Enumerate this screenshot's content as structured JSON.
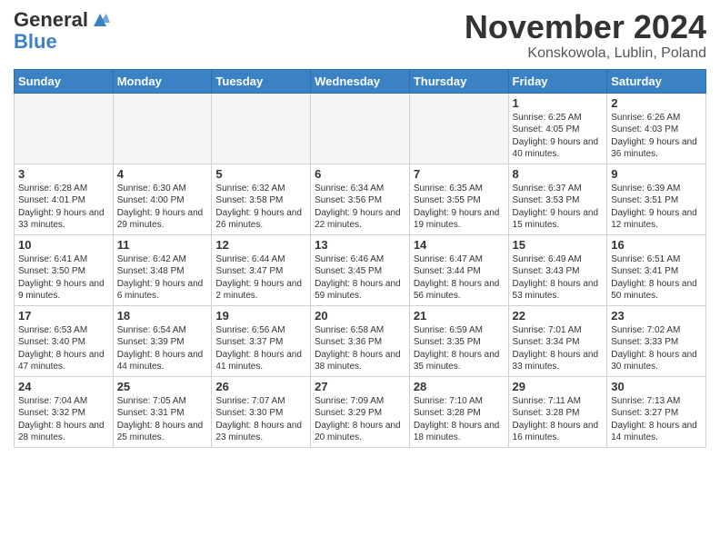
{
  "header": {
    "logo_line1": "General",
    "logo_line2": "Blue",
    "month": "November 2024",
    "location": "Konskowola, Lublin, Poland"
  },
  "days_of_week": [
    "Sunday",
    "Monday",
    "Tuesday",
    "Wednesday",
    "Thursday",
    "Friday",
    "Saturday"
  ],
  "weeks": [
    [
      {
        "num": "",
        "info": ""
      },
      {
        "num": "",
        "info": ""
      },
      {
        "num": "",
        "info": ""
      },
      {
        "num": "",
        "info": ""
      },
      {
        "num": "",
        "info": ""
      },
      {
        "num": "1",
        "info": "Sunrise: 6:25 AM\nSunset: 4:05 PM\nDaylight: 9 hours and 40 minutes."
      },
      {
        "num": "2",
        "info": "Sunrise: 6:26 AM\nSunset: 4:03 PM\nDaylight: 9 hours and 36 minutes."
      }
    ],
    [
      {
        "num": "3",
        "info": "Sunrise: 6:28 AM\nSunset: 4:01 PM\nDaylight: 9 hours and 33 minutes."
      },
      {
        "num": "4",
        "info": "Sunrise: 6:30 AM\nSunset: 4:00 PM\nDaylight: 9 hours and 29 minutes."
      },
      {
        "num": "5",
        "info": "Sunrise: 6:32 AM\nSunset: 3:58 PM\nDaylight: 9 hours and 26 minutes."
      },
      {
        "num": "6",
        "info": "Sunrise: 6:34 AM\nSunset: 3:56 PM\nDaylight: 9 hours and 22 minutes."
      },
      {
        "num": "7",
        "info": "Sunrise: 6:35 AM\nSunset: 3:55 PM\nDaylight: 9 hours and 19 minutes."
      },
      {
        "num": "8",
        "info": "Sunrise: 6:37 AM\nSunset: 3:53 PM\nDaylight: 9 hours and 15 minutes."
      },
      {
        "num": "9",
        "info": "Sunrise: 6:39 AM\nSunset: 3:51 PM\nDaylight: 9 hours and 12 minutes."
      }
    ],
    [
      {
        "num": "10",
        "info": "Sunrise: 6:41 AM\nSunset: 3:50 PM\nDaylight: 9 hours and 9 minutes."
      },
      {
        "num": "11",
        "info": "Sunrise: 6:42 AM\nSunset: 3:48 PM\nDaylight: 9 hours and 6 minutes."
      },
      {
        "num": "12",
        "info": "Sunrise: 6:44 AM\nSunset: 3:47 PM\nDaylight: 9 hours and 2 minutes."
      },
      {
        "num": "13",
        "info": "Sunrise: 6:46 AM\nSunset: 3:45 PM\nDaylight: 8 hours and 59 minutes."
      },
      {
        "num": "14",
        "info": "Sunrise: 6:47 AM\nSunset: 3:44 PM\nDaylight: 8 hours and 56 minutes."
      },
      {
        "num": "15",
        "info": "Sunrise: 6:49 AM\nSunset: 3:43 PM\nDaylight: 8 hours and 53 minutes."
      },
      {
        "num": "16",
        "info": "Sunrise: 6:51 AM\nSunset: 3:41 PM\nDaylight: 8 hours and 50 minutes."
      }
    ],
    [
      {
        "num": "17",
        "info": "Sunrise: 6:53 AM\nSunset: 3:40 PM\nDaylight: 8 hours and 47 minutes."
      },
      {
        "num": "18",
        "info": "Sunrise: 6:54 AM\nSunset: 3:39 PM\nDaylight: 8 hours and 44 minutes."
      },
      {
        "num": "19",
        "info": "Sunrise: 6:56 AM\nSunset: 3:37 PM\nDaylight: 8 hours and 41 minutes."
      },
      {
        "num": "20",
        "info": "Sunrise: 6:58 AM\nSunset: 3:36 PM\nDaylight: 8 hours and 38 minutes."
      },
      {
        "num": "21",
        "info": "Sunrise: 6:59 AM\nSunset: 3:35 PM\nDaylight: 8 hours and 35 minutes."
      },
      {
        "num": "22",
        "info": "Sunrise: 7:01 AM\nSunset: 3:34 PM\nDaylight: 8 hours and 33 minutes."
      },
      {
        "num": "23",
        "info": "Sunrise: 7:02 AM\nSunset: 3:33 PM\nDaylight: 8 hours and 30 minutes."
      }
    ],
    [
      {
        "num": "24",
        "info": "Sunrise: 7:04 AM\nSunset: 3:32 PM\nDaylight: 8 hours and 28 minutes."
      },
      {
        "num": "25",
        "info": "Sunrise: 7:05 AM\nSunset: 3:31 PM\nDaylight: 8 hours and 25 minutes."
      },
      {
        "num": "26",
        "info": "Sunrise: 7:07 AM\nSunset: 3:30 PM\nDaylight: 8 hours and 23 minutes."
      },
      {
        "num": "27",
        "info": "Sunrise: 7:09 AM\nSunset: 3:29 PM\nDaylight: 8 hours and 20 minutes."
      },
      {
        "num": "28",
        "info": "Sunrise: 7:10 AM\nSunset: 3:28 PM\nDaylight: 8 hours and 18 minutes."
      },
      {
        "num": "29",
        "info": "Sunrise: 7:11 AM\nSunset: 3:28 PM\nDaylight: 8 hours and 16 minutes."
      },
      {
        "num": "30",
        "info": "Sunrise: 7:13 AM\nSunset: 3:27 PM\nDaylight: 8 hours and 14 minutes."
      }
    ]
  ]
}
